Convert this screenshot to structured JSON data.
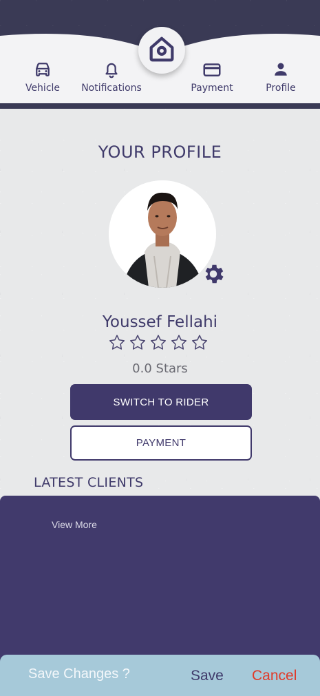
{
  "nav": {
    "items": [
      {
        "label": "Vehicle",
        "icon": "car-icon"
      },
      {
        "label": "Notifications",
        "icon": "bell-icon"
      },
      {
        "label": "Payment",
        "icon": "credit-card-icon"
      },
      {
        "label": "Profile",
        "icon": "person-icon"
      }
    ],
    "home_icon": "home-icon"
  },
  "profile": {
    "title": "YOUR PROFILE",
    "name": "Youssef Fellahi",
    "rating": 0.0,
    "rating_max": 5,
    "stars_text": "0.0 Stars",
    "avatar": "profile-photo",
    "settings_icon": "gear-icon"
  },
  "actions": {
    "switch_label": "SWITCH TO RIDER",
    "payment_label": "PAYMENT"
  },
  "clients": {
    "title": "LATEST CLIENTS",
    "view_more": "View More"
  },
  "save_bar": {
    "question": "Save Changes ?",
    "save_label": "Save",
    "cancel_label": "Cancel"
  },
  "colors": {
    "primary": "#40396b",
    "save_bar": "#a6c9d9",
    "cancel": "#e03b2a"
  }
}
